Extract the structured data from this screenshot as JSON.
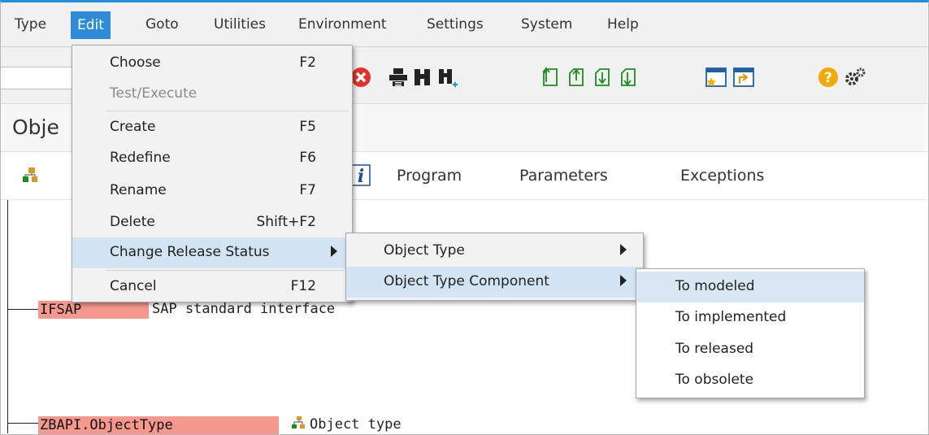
{
  "menubar": {
    "items": [
      "Type",
      "Edit",
      "Goto",
      "Utilities",
      "Environment",
      "Settings",
      "System",
      "Help"
    ],
    "active": "Edit"
  },
  "title": "Obje",
  "app_toolbar": {
    "tabs": [
      "Program",
      "Parameters",
      "Exceptions"
    ]
  },
  "edit_menu": {
    "items": [
      {
        "label": "Choose",
        "shortcut": "F2"
      },
      {
        "label": "Test/Execute",
        "shortcut": ""
      },
      {
        "label": "Create",
        "shortcut": "F5"
      },
      {
        "label": "Redefine",
        "shortcut": "F6"
      },
      {
        "label": "Rename",
        "shortcut": "F7"
      },
      {
        "label": "Delete",
        "shortcut": "Shift+F2"
      },
      {
        "label": "Change Release Status",
        "shortcut": ""
      },
      {
        "label": "Cancel",
        "shortcut": "F12"
      }
    ]
  },
  "release_submenu": {
    "items": [
      "Object Type",
      "Object Type Component"
    ]
  },
  "component_submenu": {
    "items": [
      "To modeled",
      "To implemented",
      "To released",
      "To obsolete"
    ]
  },
  "tree": {
    "node1": {
      "name": "IFSAP",
      "description": "SAP standard interface"
    },
    "node2": {
      "name": "ZBAPI.ObjectType",
      "description": "Object type"
    }
  },
  "colors": {
    "accent": "#2e8bd8",
    "highlight": "#f6988e",
    "menu_selected": "#d3e5f5"
  },
  "icons": [
    "cancel-icon",
    "print-icon",
    "find-icon",
    "find-next-icon",
    "first-page-icon",
    "previous-page-icon",
    "next-page-icon",
    "last-page-icon",
    "create-session-icon",
    "shortcut-icon",
    "help-icon",
    "settings-icon",
    "object-type-icon",
    "info-icon"
  ]
}
